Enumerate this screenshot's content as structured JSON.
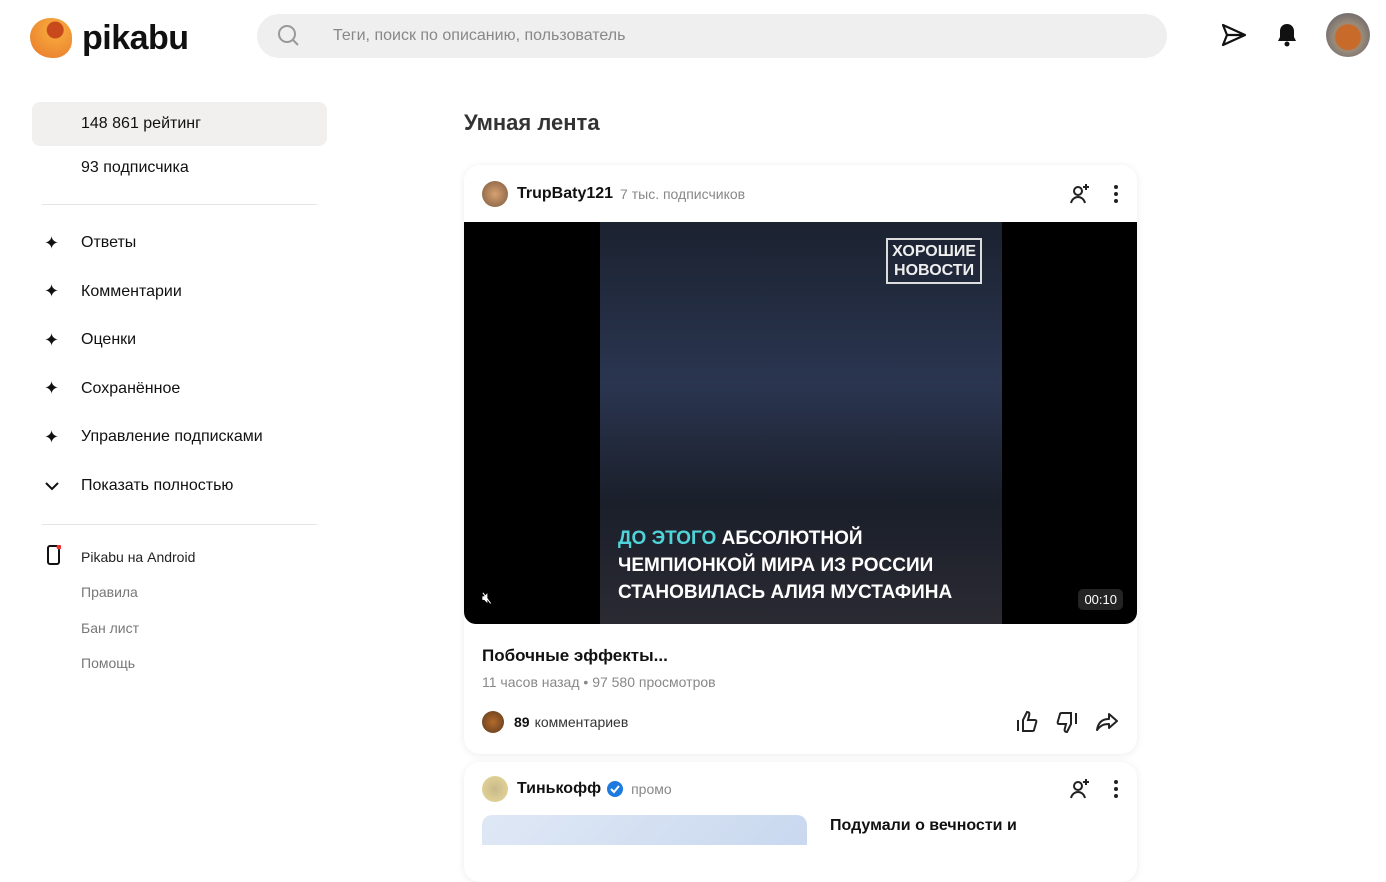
{
  "header": {
    "logo": "pikabu",
    "search_placeholder": "Теги, поиск по описанию, пользователь"
  },
  "sidebar": {
    "rating": "148 861 рейтинг",
    "subscribers": "93 подписчика",
    "items": [
      {
        "label": "Ответы"
      },
      {
        "label": "Комментарии"
      },
      {
        "label": "Оценки"
      },
      {
        "label": "Сохранённое"
      },
      {
        "label": "Управление подписками"
      }
    ],
    "show_all": "Показать полностью",
    "links": [
      "Pikabu на Android",
      "Правила",
      "Бан лист",
      "Помощь"
    ]
  },
  "feed": {
    "title": "Умная лента",
    "posts": [
      {
        "author": "TrupBaty121",
        "author_sub": "7 тыс. подписчиков",
        "video_badge": [
          "ХОРОШИЕ",
          "НОВОСТИ"
        ],
        "caption_highlight": "ДО ЭТОГО",
        "caption_line1": "АБСОЛЮТНОЙ",
        "caption_line2": "ЧЕМПИОНКОЙ МИРА ИЗ РОССИИ",
        "caption_line3": "СТАНОВИЛАСЬ АЛИЯ МУСТАФИНА",
        "duration": "00:10",
        "title": "Побочные эффекты...",
        "meta": "11 часов назад • 97 580 просмотров",
        "comments_count": "89",
        "comments_label": "комментариев"
      },
      {
        "author": "Тинькофф",
        "author_sub": "промо",
        "title": "Подумали о вечности и"
      }
    ]
  }
}
